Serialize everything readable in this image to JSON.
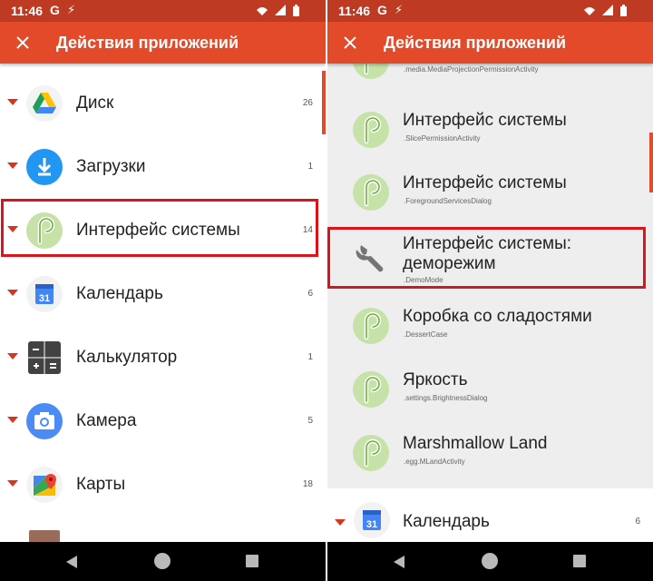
{
  "status_bar": {
    "time": "11:46",
    "g_icon": "G"
  },
  "app_bar": {
    "title": "Действия приложений"
  },
  "left_panel": {
    "items": [
      {
        "label": "Диск",
        "count": "26",
        "icon": "drive-icon"
      },
      {
        "label": "Загрузки",
        "count": "1",
        "icon": "download-icon"
      },
      {
        "label": "Интерфейс системы",
        "count": "14",
        "icon": "android-p-icon"
      },
      {
        "label": "Календарь",
        "count": "6",
        "icon": "calendar-icon",
        "icon_text": "31"
      },
      {
        "label": "Калькулятор",
        "count": "1",
        "icon": "calculator-icon"
      },
      {
        "label": "Камера",
        "count": "5",
        "icon": "camera-icon"
      },
      {
        "label": "Карты",
        "count": "18",
        "icon": "maps-icon"
      }
    ]
  },
  "right_panel": {
    "top_partial_sub": ".media.MediaProjectionPermissionActivity",
    "activities": [
      {
        "label": "Интерфейс системы",
        "sub": ".SlicePermissionActivity",
        "icon": "android-p-icon"
      },
      {
        "label": "Интерфейс системы",
        "sub": ".ForegroundServicesDialog",
        "icon": "android-p-icon"
      },
      {
        "label_line1": "Интерфейс системы:",
        "label_line2": "деморежим",
        "sub": ".DemoMode",
        "icon": "wrench-icon"
      },
      {
        "label": "Коробка со сладостями",
        "sub": ".DessertCase",
        "icon": "android-p-icon"
      },
      {
        "label": "Яркость",
        "sub": ".settings.BrightnessDialog",
        "icon": "android-p-icon"
      },
      {
        "label": "Marshmallow Land",
        "sub": ".egg.MLandActivity",
        "icon": "android-p-icon"
      }
    ],
    "bottom_item": {
      "label": "Календарь",
      "count": "6",
      "icon": "calendar-icon",
      "icon_text": "31"
    }
  },
  "colors": {
    "appbar": "#e24a2a",
    "statusbar": "#bf3a22",
    "highlight": "#d9141a",
    "caret": "#d9341f"
  }
}
